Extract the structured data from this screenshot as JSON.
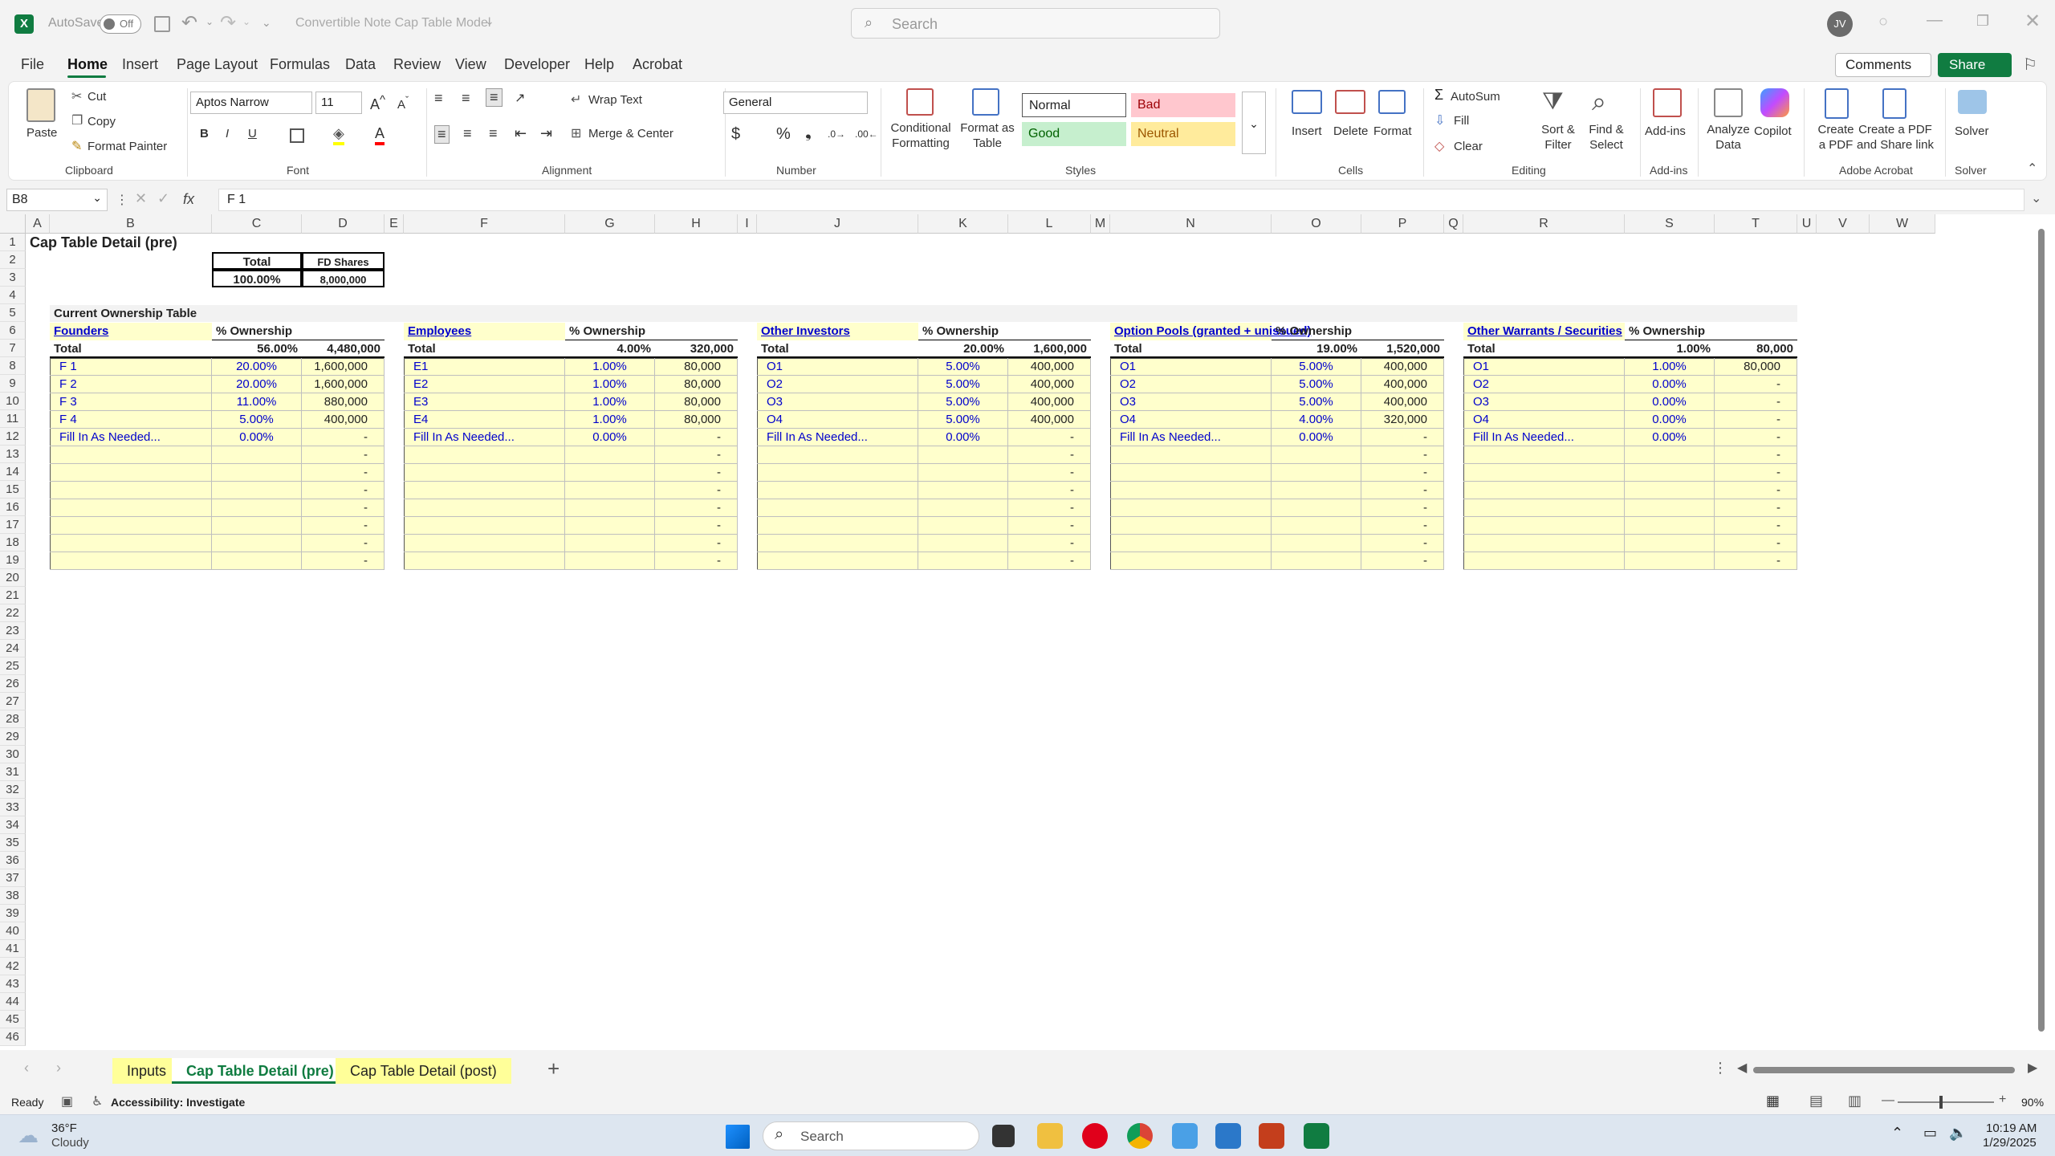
{
  "titlebar": {
    "autosave": "AutoSave",
    "off": "Off",
    "title": "Convertible Note Cap Table Model",
    "search": "Search",
    "avatar": "JV"
  },
  "menu": [
    "File",
    "Home",
    "Insert",
    "Page Layout",
    "Formulas",
    "Data",
    "Review",
    "View",
    "Developer",
    "Help",
    "Acrobat"
  ],
  "comments": "Comments",
  "share": "Share",
  "ribbon": {
    "paste": "Paste",
    "cut": "Cut",
    "copy": "Copy",
    "format_painter": "Format Painter",
    "clipboard": "Clipboard",
    "font_name": "Aptos Narrow",
    "font_size": "11",
    "font": "Font",
    "wrap": "Wrap Text",
    "merge": "Merge & Center",
    "alignment": "Alignment",
    "numfmt": "General",
    "number": "Number",
    "cond1": "Conditional",
    "cond2": "Formatting",
    "fat1": "Format as",
    "fat2": "Table",
    "style_normal": "Normal",
    "style_bad": "Bad",
    "style_good": "Good",
    "style_neutral": "Neutral",
    "styles": "Styles",
    "insert": "Insert",
    "delete": "Delete",
    "format": "Format",
    "cells": "Cells",
    "autosum": "AutoSum",
    "fill": "Fill",
    "clear": "Clear",
    "sort1": "Sort &",
    "sort2": "Filter",
    "find1": "Find &",
    "find2": "Select",
    "editing": "Editing",
    "addins": "Add-ins",
    "analyze1": "Analyze",
    "analyze2": "Data",
    "copilot": "Copilot",
    "pdf1": "Create",
    "pdf2": "a PDF",
    "pdfs1": "Create a PDF",
    "pdfs2": "and Share link",
    "acrobat": "Adobe Acrobat",
    "solver": "Solver",
    "addins_grp": "Add-ins",
    "solver_grp": "Solver"
  },
  "formula": {
    "namebox": "B8",
    "fx": "fx",
    "value": "F 1"
  },
  "columns": [
    "A",
    "B",
    "C",
    "D",
    "E",
    "F",
    "G",
    "H",
    "I",
    "J",
    "K",
    "L",
    "M",
    "N",
    "O",
    "P",
    "Q",
    "R",
    "S",
    "T",
    "U",
    "V",
    "W"
  ],
  "rows": [
    "1",
    "2",
    "3",
    "4",
    "5",
    "6",
    "7",
    "8",
    "9",
    "10",
    "11",
    "12",
    "13",
    "14",
    "15",
    "16",
    "17",
    "18",
    "19",
    "20",
    "21",
    "22",
    "23",
    "24",
    "25",
    "26",
    "27",
    "28",
    "29",
    "30",
    "31",
    "32",
    "33",
    "34",
    "35",
    "36",
    "37",
    "38",
    "39",
    "40",
    "41",
    "42",
    "43",
    "44",
    "45",
    "46"
  ],
  "sheet": {
    "title": "Cap Table Detail (pre)",
    "total_hdr": "Total",
    "fd_hdr": "FD Shares",
    "total_pct": "100.00%",
    "fd_val": "8,000,000",
    "section": "Current Ownership Table",
    "pct_hdr": "% Ownership",
    "total_label": "Total",
    "dash": "-",
    "blocks": [
      {
        "name": "Founders",
        "total_pct": "56.00%",
        "total_sh": "4,480,000",
        "rows": [
          [
            "F 1",
            "20.00%",
            "1,600,000"
          ],
          [
            "F 2",
            "20.00%",
            "1,600,000"
          ],
          [
            "F 3",
            "11.00%",
            "880,000"
          ],
          [
            "F 4",
            "5.00%",
            "400,000"
          ],
          [
            "Fill In As Needed...",
            "0.00%",
            "-"
          ]
        ]
      },
      {
        "name": "Employees",
        "total_pct": "4.00%",
        "total_sh": "320,000",
        "rows": [
          [
            "E1",
            "1.00%",
            "80,000"
          ],
          [
            "E2",
            "1.00%",
            "80,000"
          ],
          [
            "E3",
            "1.00%",
            "80,000"
          ],
          [
            "E4",
            "1.00%",
            "80,000"
          ],
          [
            "Fill In As Needed...",
            "0.00%",
            "-"
          ]
        ]
      },
      {
        "name": "Other Investors",
        "total_pct": "20.00%",
        "total_sh": "1,600,000",
        "rows": [
          [
            "O1",
            "5.00%",
            "400,000"
          ],
          [
            "O2",
            "5.00%",
            "400,000"
          ],
          [
            "O3",
            "5.00%",
            "400,000"
          ],
          [
            "O4",
            "5.00%",
            "400,000"
          ],
          [
            "Fill In As Needed...",
            "0.00%",
            "-"
          ]
        ]
      },
      {
        "name": "Option Pools (granted + unissued)",
        "total_pct": "19.00%",
        "total_sh": "1,520,000",
        "rows": [
          [
            "O1",
            "5.00%",
            "400,000"
          ],
          [
            "O2",
            "5.00%",
            "400,000"
          ],
          [
            "O3",
            "5.00%",
            "400,000"
          ],
          [
            "O4",
            "4.00%",
            "320,000"
          ],
          [
            "Fill In As Needed...",
            "0.00%",
            "-"
          ]
        ]
      },
      {
        "name": "Other Warrants / Securities",
        "total_pct": "1.00%",
        "total_sh": "80,000",
        "rows": [
          [
            "O1",
            "1.00%",
            "80,000"
          ],
          [
            "O2",
            "0.00%",
            "-"
          ],
          [
            "O3",
            "0.00%",
            "-"
          ],
          [
            "O4",
            "0.00%",
            "-"
          ],
          [
            "Fill In As Needed...",
            "0.00%",
            "-"
          ]
        ]
      }
    ]
  },
  "tabs": [
    "Inputs",
    "Cap Table Detail (pre)",
    "Cap Table Detail (post)"
  ],
  "status": {
    "ready": "Ready",
    "accessibility": "Accessibility: Investigate",
    "zoom": "90%"
  },
  "taskbar": {
    "temp": "36°F",
    "weather": "Cloudy",
    "search": "Search",
    "time": "10:19 AM",
    "date": "1/29/2025"
  },
  "colors": {
    "excel_green": "#107c41",
    "yellow": "#ffffcc",
    "link_blue": "#0000cc"
  }
}
